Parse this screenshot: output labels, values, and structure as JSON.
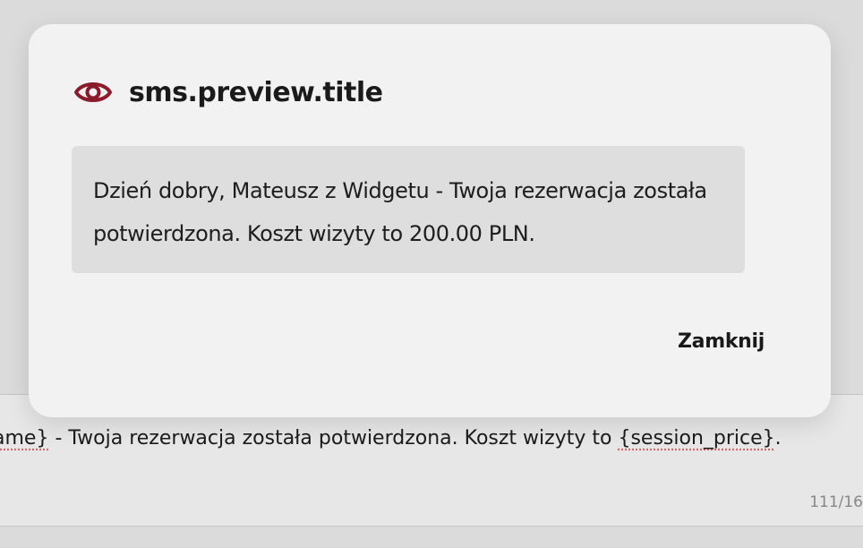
{
  "dialog": {
    "title": "sms.preview.title",
    "icon": "eye-icon",
    "accent_color": "#8b1a2b",
    "preview_text": "Dzień dobry, Mateusz z Widgetu - Twoja rezerwacja została potwierdzona. Koszt wizyty to 200.00 PLN.",
    "close_label": "Zamknij"
  },
  "background_editor": {
    "text_before": "ame}",
    "text_middle": " - Twoja rezerwacja została potwierdzona. Koszt wizyty to ",
    "text_token": "{session_price}",
    "text_after": ".",
    "counter": "111/16"
  }
}
